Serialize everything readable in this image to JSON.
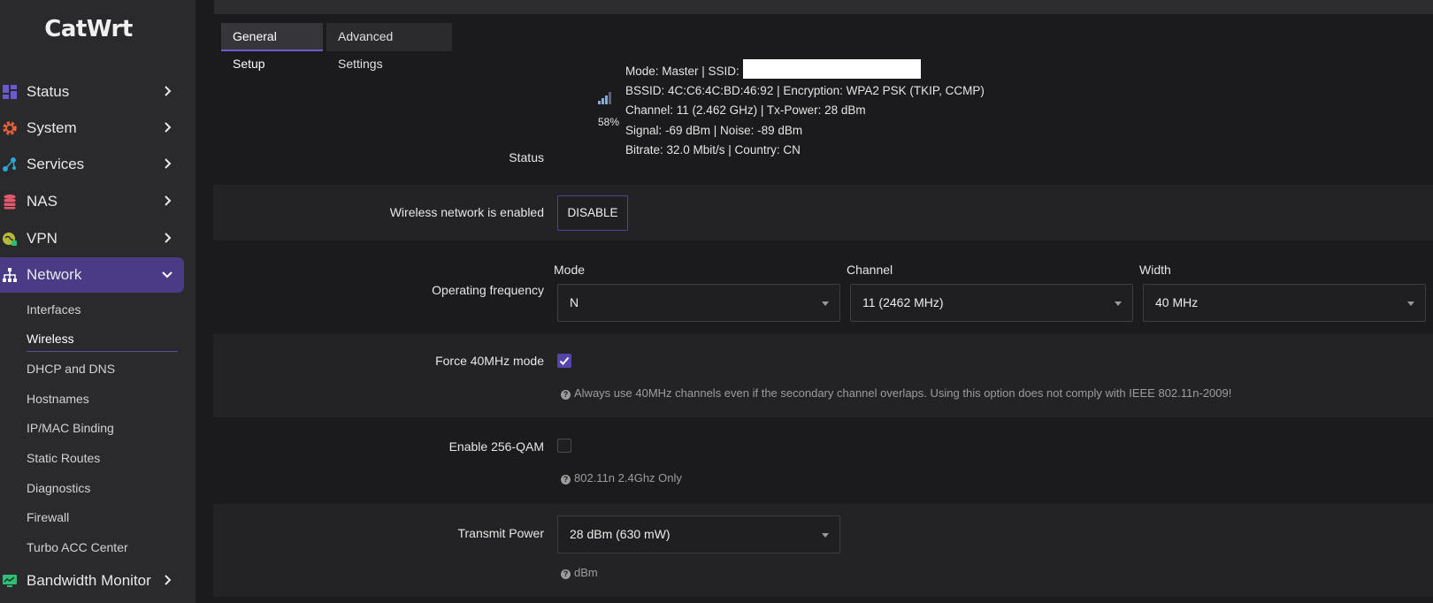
{
  "app": {
    "logo": "CatWrt"
  },
  "sidebar": {
    "items": [
      {
        "label": "Status",
        "icon": "dashboard-icon",
        "color": "#6a5acd"
      },
      {
        "label": "System",
        "icon": "gear-icon",
        "color": "#e8603c"
      },
      {
        "label": "Services",
        "icon": "services-icon",
        "color": "#2aa7d6"
      },
      {
        "label": "NAS",
        "icon": "database-icon",
        "color": "#e25a6a"
      },
      {
        "label": "VPN",
        "icon": "vpn-icon",
        "color": "#b7b93a"
      },
      {
        "label": "Network",
        "icon": "network-icon",
        "color": "#ffffff",
        "active": true
      },
      {
        "label": "Bandwidth Monitor",
        "icon": "monitor-icon",
        "color": "#2dbf76"
      }
    ],
    "network_sub": [
      "Interfaces",
      "Wireless",
      "DHCP and DNS",
      "Hostnames",
      "IP/MAC Binding",
      "Static Routes",
      "Diagnostics",
      "Firewall",
      "Turbo ACC Center"
    ],
    "current_sub": "Wireless"
  },
  "tabs": {
    "general": "General Setup",
    "advanced": "Advanced Settings"
  },
  "status": {
    "label": "Status",
    "signal_percent": "58%",
    "line1_prefix": "Mode: Master | SSID:",
    "line2": "BSSID: 4C:C6:4C:BD:46:92 | Encryption: WPA2 PSK (TKIP, CCMP)",
    "line3": "Channel: 11 (2.462 GHz) | Tx-Power: 28 dBm",
    "line4": "Signal: -69 dBm | Noise: -89 dBm",
    "line5": "Bitrate: 32.0 Mbit/s | Country: CN"
  },
  "wireless_enabled": {
    "label": "Wireless network is enabled",
    "button": "DISABLE"
  },
  "frequency": {
    "label": "Operating frequency",
    "mode_head": "Mode",
    "mode_value": "N",
    "channel_head": "Channel",
    "channel_value": "11 (2462 MHz)",
    "width_head": "Width",
    "width_value": "40 MHz"
  },
  "force40": {
    "label": "Force 40MHz mode",
    "checked": true,
    "help": "Always use 40MHz channels even if the secondary channel overlaps. Using this option does not comply with IEEE 802.11n-2009!"
  },
  "qam": {
    "label": "Enable 256-QAM",
    "checked": false,
    "help": "802.11n 2.4Ghz Only"
  },
  "txpower": {
    "label": "Transmit Power",
    "value": "28 dBm (630 mW)",
    "help": "dBm"
  },
  "colors": {
    "accent": "#4b3b87",
    "checkbox": "#5645a8",
    "bg": "#1b1b1d",
    "sidebar": "#2a2a2d"
  }
}
